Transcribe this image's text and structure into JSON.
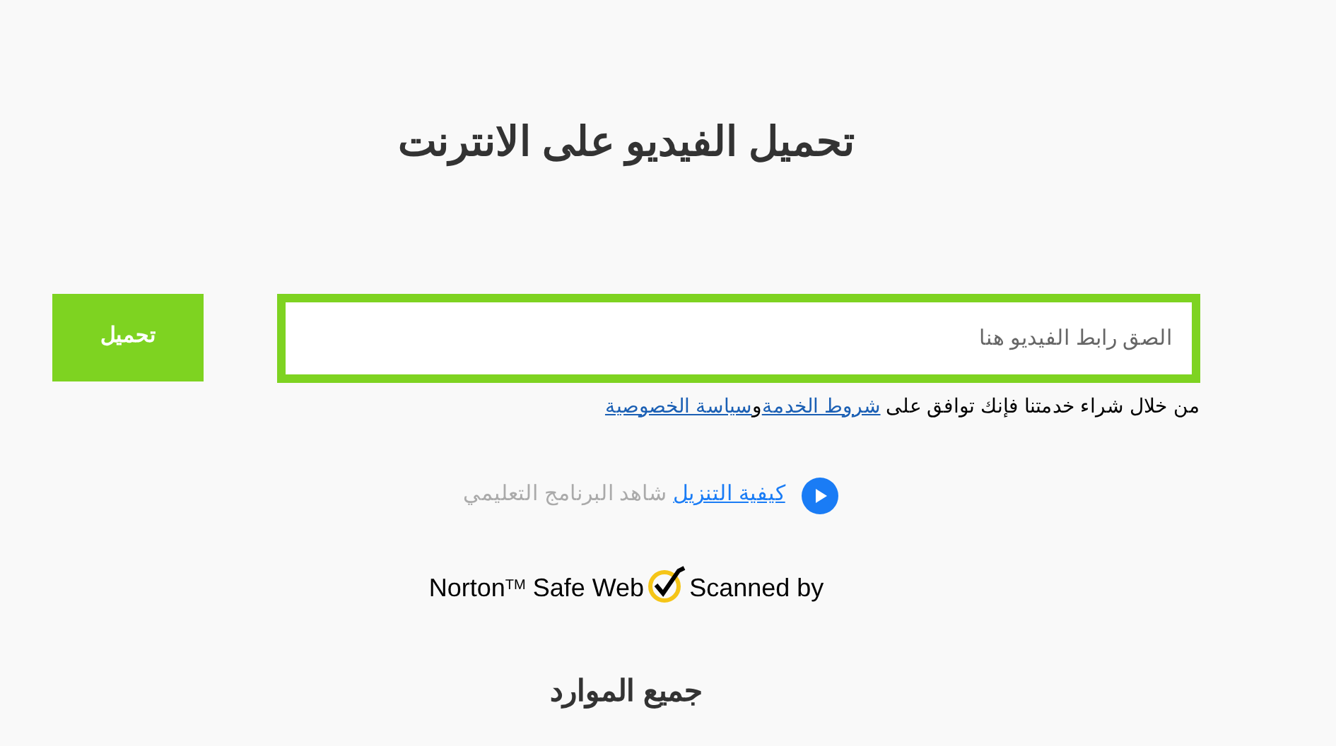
{
  "title": "تحميل الفيديو على الانترنت",
  "search": {
    "placeholder": "الصق رابط الفيديو هنا"
  },
  "download_button": "تحميل",
  "terms": {
    "text": "من خلال شراء خدمتنا فإنك توافق على ",
    "terms_link": "شروط الخدمة",
    "joiner": "و",
    "privacy_link": "سياسة الخصوصية"
  },
  "tutorial": {
    "link": "كيفية التنزيل",
    "text": "شاهد البرنامج التعليمي"
  },
  "norton": {
    "brand": "Norton$^{TM}$ Safe Web",
    "text": "Scanned by"
  },
  "resources_heading": "جميع الموارد"
}
